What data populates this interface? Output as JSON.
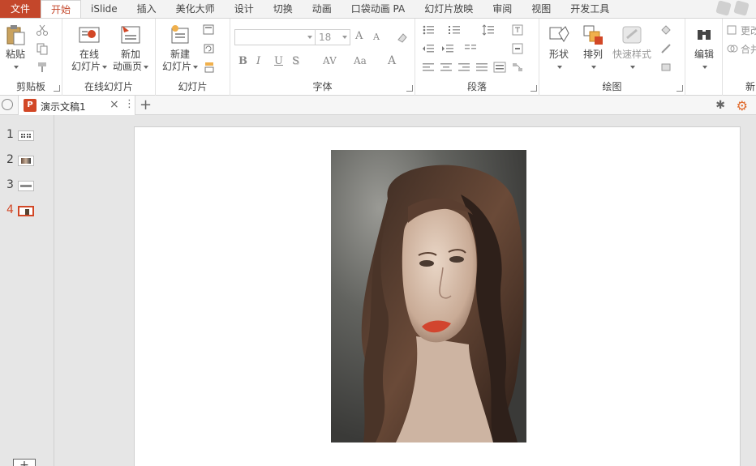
{
  "menu": {
    "tabs": [
      "文件",
      "开始",
      "iSlide",
      "插入",
      "美化大师",
      "设计",
      "切换",
      "动画",
      "口袋动画 PA",
      "幻灯片放映",
      "审阅",
      "视图",
      "开发工具"
    ],
    "active_index": 1
  },
  "ribbon": {
    "clipboard": {
      "paste_label": "粘贴",
      "group_label": "剪贴板"
    },
    "online_slides": {
      "online_label_1": "在线",
      "online_label_2": "幻灯片",
      "new_anim_label_1": "新加",
      "new_anim_label_2": "动画页",
      "group_label": "在线幻灯片"
    },
    "slides": {
      "new_label_1": "新建",
      "new_label_2": "幻灯片",
      "group_label": "幻灯片"
    },
    "font": {
      "font_name": "",
      "font_size": "18",
      "group_label": "字体",
      "grow": "A",
      "shrink": "A",
      "bold": "B",
      "italic": "I",
      "underline": "U",
      "shadow": "S",
      "spacing": "AV",
      "case": "Aa",
      "color": "A"
    },
    "paragraph": {
      "group_label": "段落"
    },
    "drawing": {
      "shapes_label": "形状",
      "arrange_label": "排列",
      "quick_styles_label": "快速样式",
      "group_label": "绘图"
    },
    "editing": {
      "edit_label": "编辑"
    },
    "extra": {
      "update_label": "更改",
      "merge_label": "合并",
      "new_label": "新"
    }
  },
  "document": {
    "tab_title": "演示文稿1",
    "app_badge": "P"
  },
  "slides_pane": {
    "items": [
      {
        "number": "1"
      },
      {
        "number": "2"
      },
      {
        "number": "3"
      },
      {
        "number": "4"
      }
    ],
    "active_index": 3,
    "add_label": "+"
  },
  "colors": {
    "accent": "#c4472b",
    "ppt_badge": "#d24726",
    "ribbon_bg": "#ffffff",
    "workspace_bg": "#e6e6e6"
  },
  "slide": {
    "image_description": "portrait-photo"
  }
}
